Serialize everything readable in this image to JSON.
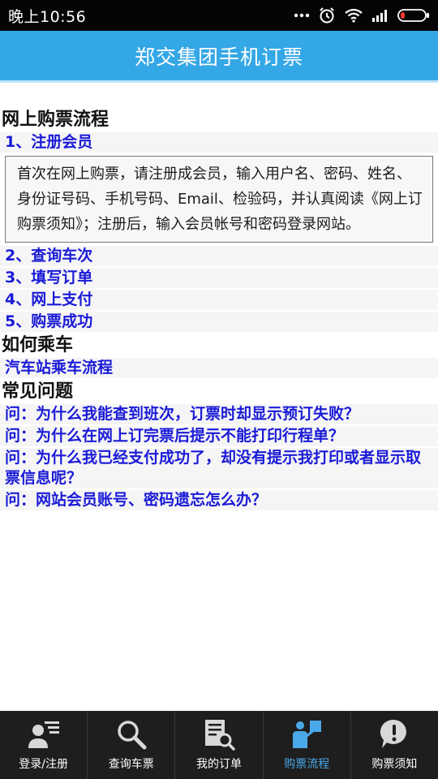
{
  "status_bar": {
    "time": "晚上10:56",
    "icons": [
      "more-dots-icon",
      "alarm-clock-icon",
      "wifi-icon",
      "signal-icon",
      "battery-icon"
    ]
  },
  "header": {
    "title": "郑交集团手机订票"
  },
  "sections": {
    "purchase_flow": {
      "title": "网上购票流程",
      "step1": "1、注册会员",
      "step1_detail": "首次在网上购票，请注册成会员，输入用户名、密码、姓名、身份证号码、手机号码、Email、检验码，并认真阅读《网上订购票须知》；注册后，输入会员帐号和密码登录网站。",
      "step2": "2、查询车次",
      "step3": "3、填写订单",
      "step4": "4、网上支付",
      "step5": "5、购票成功"
    },
    "boarding": {
      "title": "如何乘车",
      "item1": "汽车站乘车流程"
    },
    "faq": {
      "title": "常见问题",
      "q1": "问：为什么我能查到班次，订票时却显示预订失败？",
      "q2": "问：为什么在网上订完票后提示不能打印行程单？",
      "q3": "问：为什么我已经支付成功了，却没有提示我打印或者显示取票信息呢？",
      "q4": "问：网站会员账号、密码遗忘怎么办？"
    }
  },
  "tabbar": {
    "tabs": [
      {
        "label": "登录/注册",
        "icon": "user-login-icon"
      },
      {
        "label": "查询车票",
        "icon": "search-icon"
      },
      {
        "label": "我的订单",
        "icon": "order-document-icon"
      },
      {
        "label": "购票流程",
        "icon": "purchase-flow-icon",
        "active": true
      },
      {
        "label": "购票须知",
        "icon": "notice-exclamation-icon"
      }
    ]
  },
  "colors": {
    "header_blue": "#34a7e6",
    "link_blue": "#1a1ad8",
    "active_tab": "#4aa9e8"
  }
}
